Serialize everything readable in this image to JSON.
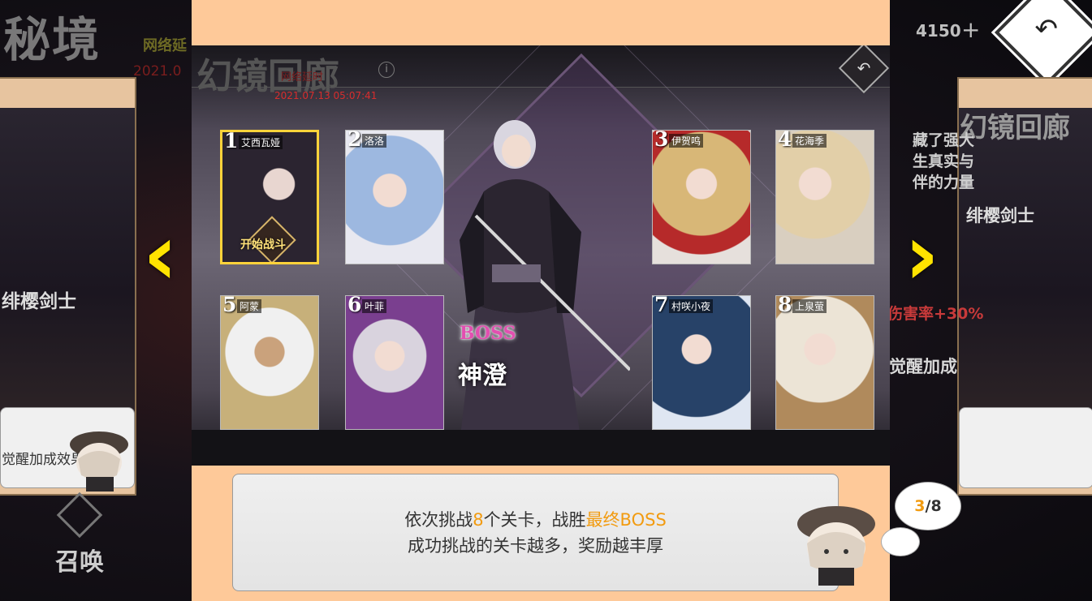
{
  "background": {
    "title": "秘境",
    "subtitle": "网络延",
    "date": "2021.0",
    "currency": "4150",
    "plus": "+",
    "left_card_name": "绯樱剑士",
    "left_card_bonus": "觉醒加成效果",
    "right_card_title": "幻镜回廊",
    "right_card_name": "绯樱剑士",
    "right_text_lines": [
      "藏了强大",
      "生真实与",
      "伴的力量"
    ],
    "right_rate": "伤害率+30%",
    "right_bonus": "觉醒加成",
    "summon_label": "召唤"
  },
  "preview": {
    "title": "幻镜回廊",
    "network": "网络延时",
    "date": "2021.07.13 05:07:41",
    "boss_tag": "BOSS",
    "boss_name": "神澄",
    "start_battle": "开始战斗",
    "stages": [
      {
        "num": "1",
        "name": "艾西瓦娅",
        "active": true,
        "color": "#2b2430"
      },
      {
        "num": "2",
        "name": "洛洛",
        "active": false,
        "color": "#9db8e0"
      },
      {
        "num": "3",
        "name": "伊贺鸣",
        "active": false,
        "color": "#d8b777"
      },
      {
        "num": "4",
        "name": "花海季",
        "active": false,
        "color": "#d9cfc0"
      },
      {
        "num": "5",
        "name": "阿蒙",
        "active": false,
        "color": "#c7b07a"
      },
      {
        "num": "6",
        "name": "叶菲",
        "active": false,
        "color": "#7a3f8f"
      },
      {
        "num": "7",
        "name": "村咲小夜",
        "active": false,
        "color": "#274268"
      },
      {
        "num": "8",
        "name": "上泉萤",
        "active": false,
        "color": "#d7cbb8"
      }
    ]
  },
  "tutorial": {
    "line1_a": "依次挑战",
    "line1_num": "8",
    "line1_b": "个关卡，战胜",
    "line1_hl": "最终BOSS",
    "line2": "成功挑战的关卡越多，奖励越丰厚",
    "page_current": "3",
    "page_total": "/8"
  },
  "colors": {
    "panel": "#fec999",
    "accent": "#f29b10",
    "arrow": "#ffe300"
  }
}
